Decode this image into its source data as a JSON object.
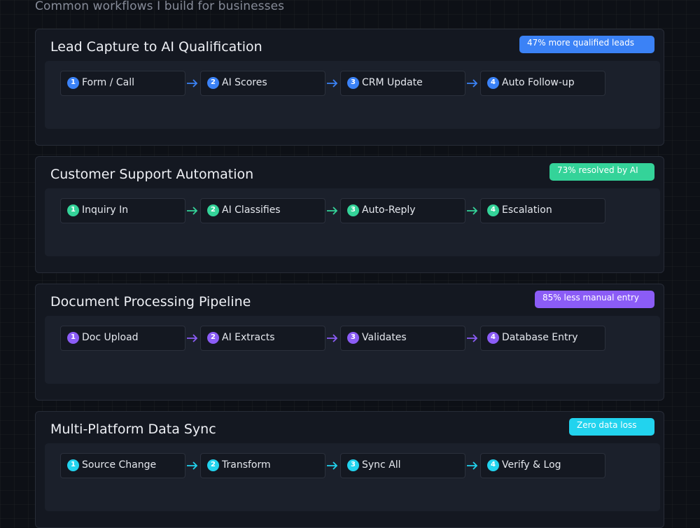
{
  "subtitle": "Common workflows I build for businesses",
  "workflows": [
    {
      "title": "Lead Capture to AI Qualification",
      "badge": "47% more qualified leads",
      "accent": "#3b82f6",
      "steps": [
        {
          "n": "1",
          "label": "Form / Call"
        },
        {
          "n": "2",
          "label": "AI Scores"
        },
        {
          "n": "3",
          "label": "CRM Update"
        },
        {
          "n": "4",
          "label": "Auto Follow-up"
        }
      ]
    },
    {
      "title": "Customer Support Automation",
      "badge": "73% resolved by AI",
      "accent": "#34d399",
      "steps": [
        {
          "n": "1",
          "label": "Inquiry In"
        },
        {
          "n": "2",
          "label": "AI Classifies"
        },
        {
          "n": "3",
          "label": "Auto-Reply"
        },
        {
          "n": "4",
          "label": "Escalation"
        }
      ]
    },
    {
      "title": "Document Processing Pipeline",
      "badge": "85% less manual entry",
      "accent": "#8b5cf6",
      "steps": [
        {
          "n": "1",
          "label": "Doc Upload"
        },
        {
          "n": "2",
          "label": "AI Extracts"
        },
        {
          "n": "3",
          "label": "Validates"
        },
        {
          "n": "4",
          "label": "Database Entry"
        }
      ]
    },
    {
      "title": "Multi-Platform Data Sync",
      "badge": "Zero data loss",
      "accent": "#22d3ee",
      "steps": [
        {
          "n": "1",
          "label": "Source Change"
        },
        {
          "n": "2",
          "label": "Transform"
        },
        {
          "n": "3",
          "label": "Sync All"
        },
        {
          "n": "4",
          "label": "Verify & Log"
        }
      ]
    }
  ]
}
